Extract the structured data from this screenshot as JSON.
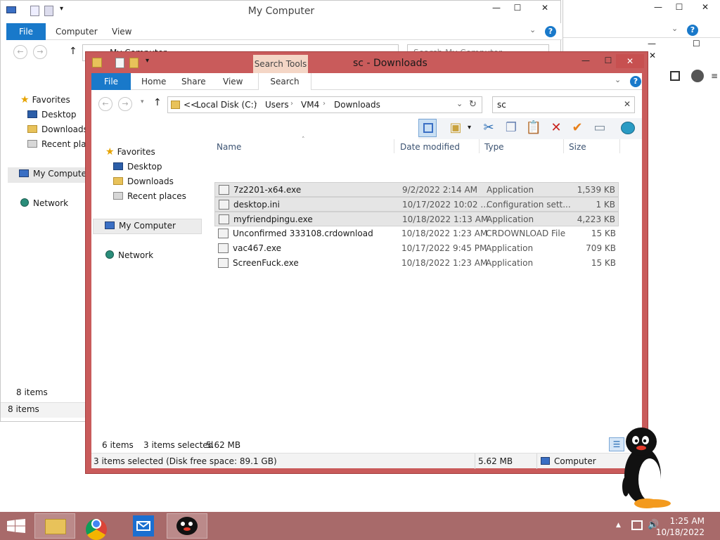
{
  "bg_window": {
    "title": "My Computer",
    "tabs": {
      "file": "File",
      "computer": "Computer",
      "view": "View"
    },
    "address": "My Computer",
    "search_placeholder": "Search My Computer",
    "nav": {
      "favorites": "Favorites",
      "desktop": "Desktop",
      "downloads": "Downloads",
      "recent": "Recent places",
      "my_computer": "My Computer",
      "network": "Network"
    },
    "status_items": "8 items",
    "status_items2": "8 items"
  },
  "main_window": {
    "title": "sc - Downloads",
    "contextual_tab": "Search Tools",
    "tabs": {
      "file": "File",
      "home": "Home",
      "share": "Share",
      "view": "View",
      "search": "Search"
    },
    "breadcrumb": [
      "Local Disk (C:)",
      "Users",
      "VM4",
      "Downloads"
    ],
    "breadcrumb_prefix": "<<",
    "search_value": "sc",
    "nav": {
      "favorites": "Favorites",
      "desktop": "Desktop",
      "downloads": "Downloads",
      "recent": "Recent places",
      "my_computer": "My Computer",
      "network": "Network"
    },
    "columns": {
      "name": "Name",
      "date": "Date modified",
      "type": "Type",
      "size": "Size"
    },
    "files": [
      {
        "name": "7z2201-x64.exe",
        "date": "9/2/2022 2:14 AM",
        "type": "Application",
        "size": "1,539 KB",
        "selected": true
      },
      {
        "name": "desktop.ini",
        "date": "10/17/2022 10:02 ...",
        "type": "Configuration sett...",
        "size": "1 KB",
        "selected": true
      },
      {
        "name": "myfriendpingu.exe",
        "date": "10/18/2022 1:13 AM",
        "type": "Application",
        "size": "4,223 KB",
        "selected": true
      },
      {
        "name": "Unconfirmed 333108.crdownload",
        "date": "10/18/2022 1:23 AM",
        "type": "CRDOWNLOAD File",
        "size": "15 KB",
        "selected": false
      },
      {
        "name": "vac467.exe",
        "date": "10/17/2022 9:45 PM",
        "type": "Application",
        "size": "709 KB",
        "selected": false
      },
      {
        "name": "ScreenFuck.exe",
        "date": "10/18/2022 1:23 AM",
        "type": "Application",
        "size": "15 KB",
        "selected": false
      }
    ],
    "status": {
      "count": "6 items",
      "selected": "3 items selected",
      "selected_size": "5.62 MB"
    },
    "details_bar": {
      "text": "3 items selected (Disk free space: 89.1 GB)",
      "size": "5.62 MB",
      "location": "Computer"
    }
  },
  "taskbar": {
    "time": "1:25 AM",
    "date": "10/18/2022"
  },
  "colors": {
    "accent": "#1979ca",
    "window_frame": "#c95b5b",
    "taskbar": "#a86a6a"
  }
}
